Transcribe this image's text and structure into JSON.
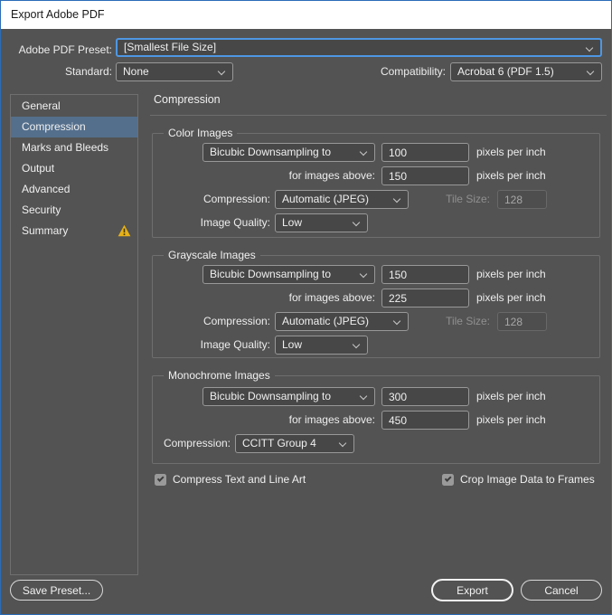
{
  "window": {
    "title": "Export Adobe PDF"
  },
  "colors": {
    "dialog_bg": "#535353",
    "titlebar_bg": "#ffffff",
    "focus_blue": "#4e97e4",
    "window_border_blue": "#2a6cb8",
    "sidebar_selected": "#546f8c",
    "warning_yellow": "#e7b219"
  },
  "header": {
    "preset_label": "Adobe PDF Preset:",
    "preset_value": "[Smallest File Size]",
    "standard_label": "Standard:",
    "standard_value": "None",
    "compatibility_label": "Compatibility:",
    "compatibility_value": "Acrobat 6 (PDF 1.5)"
  },
  "sidebar": {
    "items": [
      {
        "label": "General"
      },
      {
        "label": "Compression"
      },
      {
        "label": "Marks and Bleeds"
      },
      {
        "label": "Output"
      },
      {
        "label": "Advanced"
      },
      {
        "label": "Security"
      },
      {
        "label": "Summary"
      }
    ],
    "selected_index": 1,
    "warning_icon": "warning-triangle"
  },
  "main": {
    "heading": "Compression",
    "groups": [
      {
        "title": "Color Images",
        "sampling": "Bicubic Downsampling to",
        "resolution": "100",
        "res_unit": "pixels per inch",
        "above_label": "for images above:",
        "above_value": "150",
        "above_unit": "pixels per inch",
        "compression_label": "Compression:",
        "compression_value": "Automatic (JPEG)",
        "tile_label": "Tile Size:",
        "tile_value": "128",
        "quality_label": "Image Quality:",
        "quality_value": "Low"
      },
      {
        "title": "Grayscale Images",
        "sampling": "Bicubic Downsampling to",
        "resolution": "150",
        "res_unit": "pixels per inch",
        "above_label": "for images above:",
        "above_value": "225",
        "above_unit": "pixels per inch",
        "compression_label": "Compression:",
        "compression_value": "Automatic (JPEG)",
        "tile_label": "Tile Size:",
        "tile_value": "128",
        "quality_label": "Image Quality:",
        "quality_value": "Low"
      },
      {
        "title": "Monochrome Images",
        "sampling": "Bicubic Downsampling to",
        "resolution": "300",
        "res_unit": "pixels per inch",
        "above_label": "for images above:",
        "above_value": "450",
        "above_unit": "pixels per inch",
        "compression_label": "Compression:",
        "compression_value": "CCITT Group 4"
      }
    ],
    "checkboxes": [
      {
        "label": "Compress Text and Line Art",
        "checked": true
      },
      {
        "label": "Crop Image Data to Frames",
        "checked": true
      }
    ]
  },
  "footer": {
    "save_preset": "Save Preset...",
    "export": "Export",
    "cancel": "Cancel"
  }
}
